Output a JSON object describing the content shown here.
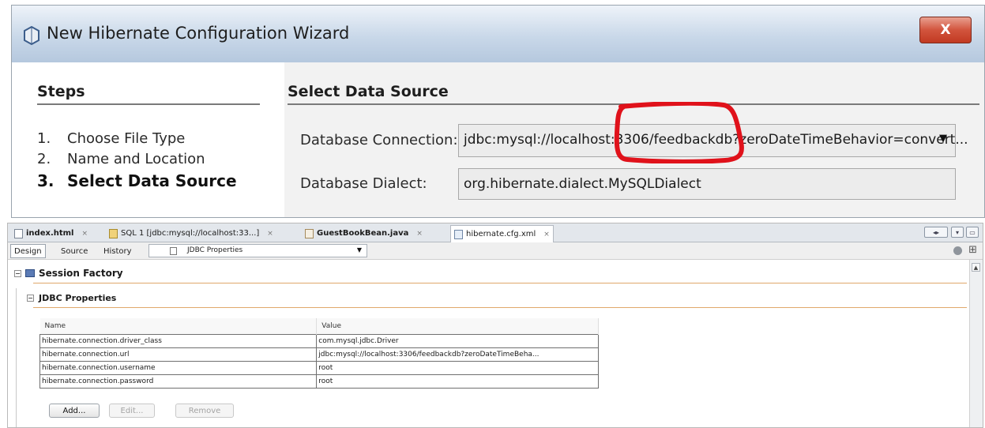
{
  "wizard": {
    "title": "New Hibernate Configuration Wizard",
    "close_label": "X",
    "steps_heading": "Steps",
    "steps": [
      {
        "num": "1.",
        "label": "Choose File Type"
      },
      {
        "num": "2.",
        "label": "Name and Location"
      },
      {
        "num": "3.",
        "label": "Select Data Source"
      }
    ],
    "panel_heading": "Select Data Source",
    "connection_label": "Database Connection:",
    "connection_value": "jdbc:mysql://localhost:3306/feedbackdb?zeroDateTimeBehavior=convert...",
    "dialect_label": "Database Dialect:",
    "dialect_value": "org.hibernate.dialect.MySQLDialect",
    "highlight_color": "#e0121b"
  },
  "ide": {
    "tabs": [
      {
        "label": "index.html",
        "icon": "html-file-icon"
      },
      {
        "label": "SQL 1 [jdbc:mysql://localhost:33...]",
        "icon": "sql-file-icon"
      },
      {
        "label": "GuestBookBean.java",
        "icon": "java-file-icon"
      },
      {
        "label": "hibernate.cfg.xml",
        "icon": "xml-file-icon"
      }
    ],
    "tab_close": "×",
    "views": {
      "design": "Design",
      "source": "Source",
      "history": "History"
    },
    "section_dropdown": "JDBC Properties",
    "session_factory": "Session Factory",
    "jdbc_properties": "JDBC Properties",
    "table": {
      "headers": [
        "Name",
        "Value"
      ],
      "rows": [
        [
          "hibernate.connection.driver_class",
          "com.mysql.jdbc.Driver"
        ],
        [
          "hibernate.connection.url",
          "jdbc:mysql://localhost:3306/feedbackdb?zeroDateTimeBeha..."
        ],
        [
          "hibernate.connection.username",
          "root"
        ],
        [
          "hibernate.connection.password",
          "root"
        ]
      ]
    },
    "buttons": {
      "add": "Add...",
      "edit": "Edit...",
      "remove": "Remove"
    }
  }
}
